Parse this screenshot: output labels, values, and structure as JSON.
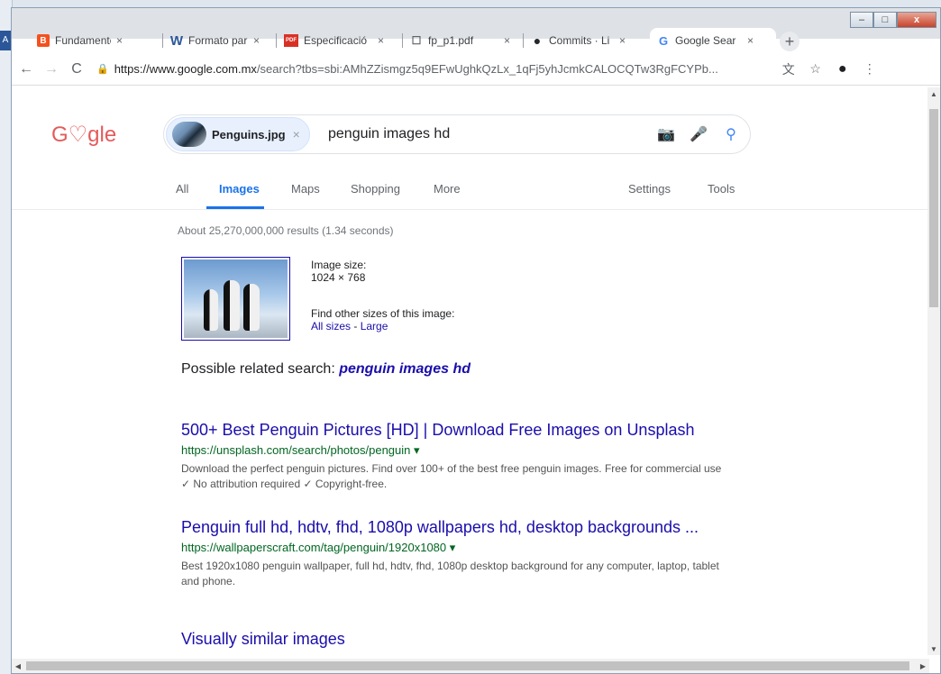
{
  "browser": {
    "tabs": [
      {
        "label": "Fundamento",
        "icon": "B",
        "icon_color": "#f4511e"
      },
      {
        "label": "Formato par",
        "icon": "W",
        "icon_color": "#2b579a"
      },
      {
        "label": "Especificació",
        "icon": "PDF",
        "icon_color": "#d93025"
      },
      {
        "label": "fp_p1.pdf",
        "icon": "☐",
        "icon_color": "#5f6368"
      },
      {
        "label": "Commits · Li",
        "icon": "●",
        "icon_color": "#24292e"
      },
      {
        "label": "Google Sear",
        "icon": "G",
        "icon_color": "#4285f4"
      }
    ],
    "tab_close": "×",
    "new_tab": "+",
    "url_host": "https://www.google.com.mx",
    "url_path": "/search?tbs=sbi:AMhZZismgz5q9EFwUghkQzLx_1qFj5yhJcmkCALOCQTw3RgFCYPb..."
  },
  "google": {
    "logo": "G♡gle",
    "chip_name": "Penguins.jpg",
    "query": "penguin images hd",
    "nav": [
      "All",
      "Images",
      "Maps",
      "Shopping",
      "More",
      "Settings",
      "Tools"
    ],
    "stats": "About 25,270,000,000 results (1.34 seconds)",
    "image_size_label": "Image size:",
    "image_size_value": "1024 × 768",
    "other_sizes_label": "Find other sizes of this image:",
    "all_sizes": "All sizes",
    "size_sep": " - ",
    "large": "Large",
    "related_label": "Possible related search: ",
    "related_query": "penguin images hd",
    "results": [
      {
        "title": "500+ Best Penguin Pictures [HD] | Download Free Images on Unsplash",
        "url": "https://unsplash.com/search/photos/penguin ▾",
        "desc": "Download the perfect penguin pictures. Find over 100+ of the best free penguin images. Free for commercial use ✓ No attribution required ✓ Copyright-free."
      },
      {
        "title": "Penguin full hd, hdtv, fhd, 1080p wallpapers hd, desktop backgrounds ...",
        "url": "https://wallpaperscraft.com/tag/penguin/1920x1080 ▾",
        "desc": "Best 1920x1080 penguin wallpaper, full hd, hdtv, fhd, 1080p desktop background for any computer, laptop, tablet and phone."
      }
    ],
    "similar": "Visually similar images"
  }
}
